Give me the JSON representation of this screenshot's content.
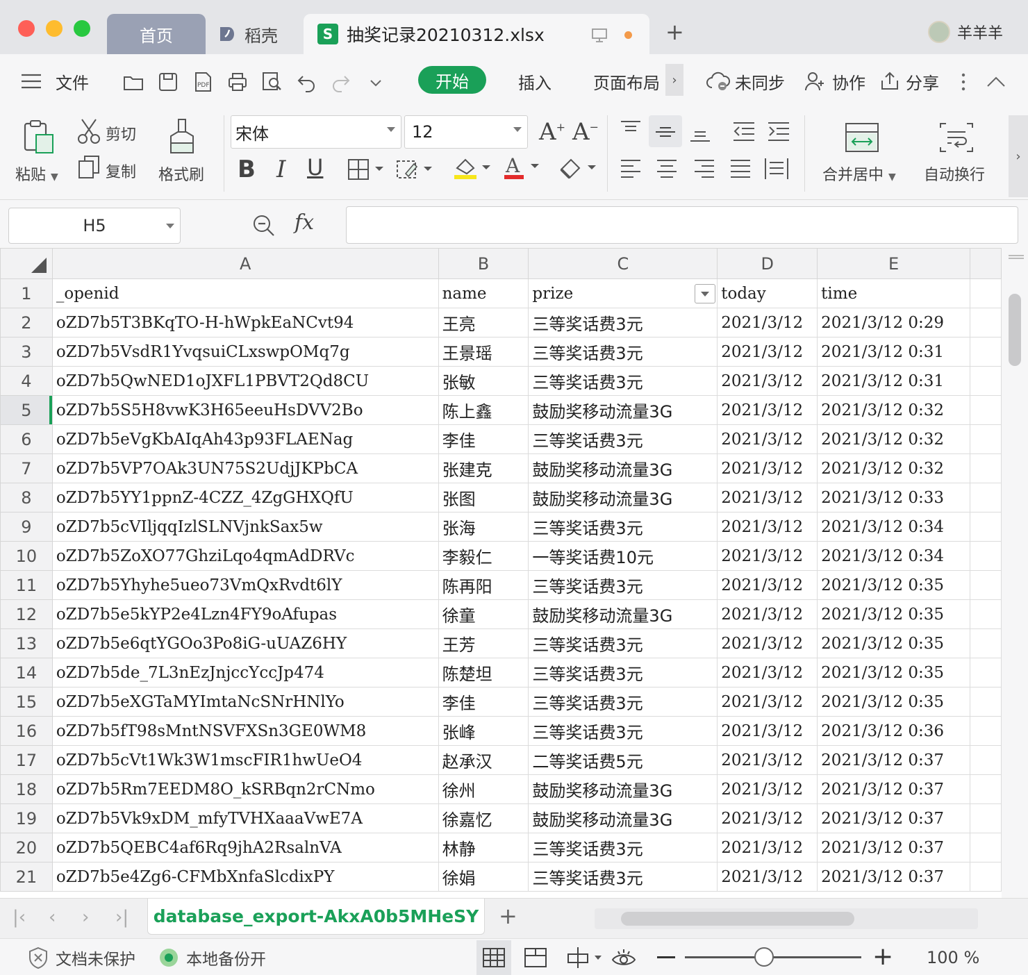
{
  "tabs": {
    "home": "首页",
    "daoke": "稻壳",
    "file": "抽奖记录20210312.xlsx"
  },
  "user": {
    "name": "羊羊羊"
  },
  "menu": {
    "file": "文件",
    "start": "开始",
    "insert": "插入",
    "layout": "页面布局",
    "sync": "未同步",
    "collab": "协作",
    "share": "分享"
  },
  "ribbon": {
    "paste": "粘贴",
    "cut": "剪切",
    "copy": "复制",
    "format_painter": "格式刷",
    "font": "宋体",
    "font_size": "12",
    "merge_center": "合并居中",
    "wrap": "自动换行"
  },
  "formula": {
    "cell_ref": "H5",
    "fx": "fx",
    "content": ""
  },
  "columns": [
    "A",
    "B",
    "C",
    "D",
    "E"
  ],
  "header_row": {
    "row": "1",
    "cells": [
      "_openid",
      "name",
      "prize",
      "today",
      "time"
    ]
  },
  "rows": [
    {
      "n": "2",
      "c": [
        "oZD7b5T3BKqTO-H-hWpkEaNCvt94",
        "王亮",
        "三等奖话费3元",
        "2021/3/12",
        "2021/3/12 0:29"
      ]
    },
    {
      "n": "3",
      "c": [
        "oZD7b5VsdR1YvqsuiCLxswpOMq7g",
        "王景瑶",
        "三等奖话费3元",
        "2021/3/12",
        "2021/3/12 0:31"
      ]
    },
    {
      "n": "4",
      "c": [
        "oZD7b5QwNED1oJXFL1PBVT2Qd8CU",
        "张敏",
        "三等奖话费3元",
        "2021/3/12",
        "2021/3/12 0:31"
      ]
    },
    {
      "n": "5",
      "c": [
        "oZD7b5S5H8vwK3H65eeuHsDVV2Bo",
        "陈上鑫",
        "鼓励奖移动流量3G",
        "2021/3/12",
        "2021/3/12 0:32"
      ]
    },
    {
      "n": "6",
      "c": [
        "oZD7b5eVgKbAIqAh43p93FLAENag",
        "李佳",
        "三等奖话费3元",
        "2021/3/12",
        "2021/3/12 0:32"
      ]
    },
    {
      "n": "7",
      "c": [
        "oZD7b5VP7OAk3UN75S2UdjJKPbCA",
        "张建克",
        "鼓励奖移动流量3G",
        "2021/3/12",
        "2021/3/12 0:32"
      ]
    },
    {
      "n": "8",
      "c": [
        "oZD7b5YY1ppnZ-4CZZ_4ZgGHXQfU",
        "张图",
        "鼓励奖移动流量3G",
        "2021/3/12",
        "2021/3/12 0:33"
      ]
    },
    {
      "n": "9",
      "c": [
        "oZD7b5cVIljqqIzlSLNVjnkSax5w",
        "张海",
        "三等奖话费3元",
        "2021/3/12",
        "2021/3/12 0:34"
      ]
    },
    {
      "n": "10",
      "c": [
        "oZD7b5ZoXO77GhziLqo4qmAdDRVc",
        "李毅仁",
        "一等奖话费10元",
        "2021/3/12",
        "2021/3/12 0:34"
      ]
    },
    {
      "n": "11",
      "c": [
        "oZD7b5Yhyhe5ueo73VmQxRvdt6lY",
        "陈再阳",
        "三等奖话费3元",
        "2021/3/12",
        "2021/3/12 0:35"
      ]
    },
    {
      "n": "12",
      "c": [
        "oZD7b5e5kYP2e4Lzn4FY9oAfupas",
        "徐童",
        "鼓励奖移动流量3G",
        "2021/3/12",
        "2021/3/12 0:35"
      ]
    },
    {
      "n": "13",
      "c": [
        "oZD7b5e6qtYGOo3Po8iG-uUAZ6HY",
        "王芳",
        "三等奖话费3元",
        "2021/3/12",
        "2021/3/12 0:35"
      ]
    },
    {
      "n": "14",
      "c": [
        "oZD7b5de_7L3nEzJnjccYccJp474",
        "陈楚坦",
        "三等奖话费3元",
        "2021/3/12",
        "2021/3/12 0:35"
      ]
    },
    {
      "n": "15",
      "c": [
        "oZD7b5eXGTaMYImtaNcSNrHNlYo",
        "李佳",
        "三等奖话费3元",
        "2021/3/12",
        "2021/3/12 0:35"
      ]
    },
    {
      "n": "16",
      "c": [
        "oZD7b5fT98sMntNSVFXSn3GE0WM8",
        "张峰",
        "三等奖话费3元",
        "2021/3/12",
        "2021/3/12 0:36"
      ]
    },
    {
      "n": "17",
      "c": [
        "oZD7b5cVt1Wk3W1mscFIR1hwUeO4",
        "赵承汉",
        "二等奖话费5元",
        "2021/3/12",
        "2021/3/12 0:37"
      ]
    },
    {
      "n": "18",
      "c": [
        "oZD7b5Rm7EEDM8O_kSRBqn2rCNmo",
        "徐州",
        "鼓励奖移动流量3G",
        "2021/3/12",
        "2021/3/12 0:37"
      ]
    },
    {
      "n": "19",
      "c": [
        "oZD7b5Vk9xDM_mfyTVHXaaaVwE7A",
        "徐嘉忆",
        "鼓励奖移动流量3G",
        "2021/3/12",
        "2021/3/12 0:37"
      ]
    },
    {
      "n": "20",
      "c": [
        "oZD7b5QEBC4af6Rq9jhA2RsalnVA",
        "林静",
        "三等奖话费3元",
        "2021/3/12",
        "2021/3/12 0:37"
      ]
    },
    {
      "n": "21",
      "c": [
        "oZD7b5e4Zg6-CFMbXnfaSlcdixPY",
        "徐娟",
        "三等奖话费3元",
        "2021/3/12",
        "2021/3/12 0:37"
      ]
    }
  ],
  "sheet_tab": "database_export-AkxA0b5MHeSY",
  "status": {
    "protect": "文档未保护",
    "backup": "本地备份开",
    "zoom": "100 %",
    "zoom_level": 0.45
  },
  "colors": {
    "accent": "#1aa058",
    "close": "#fe5f57",
    "minimize": "#febc2e",
    "maximize": "#28c840"
  },
  "icons": [
    "menu-icon",
    "open-folder-icon",
    "save-icon",
    "pdf-icon",
    "print-icon",
    "preview-icon",
    "undo-icon",
    "redo-icon",
    "cloud-icon",
    "add-user-icon",
    "share-icon",
    "more-icon",
    "collapse-icon",
    "zoom-search-icon",
    "shield-icon"
  ]
}
